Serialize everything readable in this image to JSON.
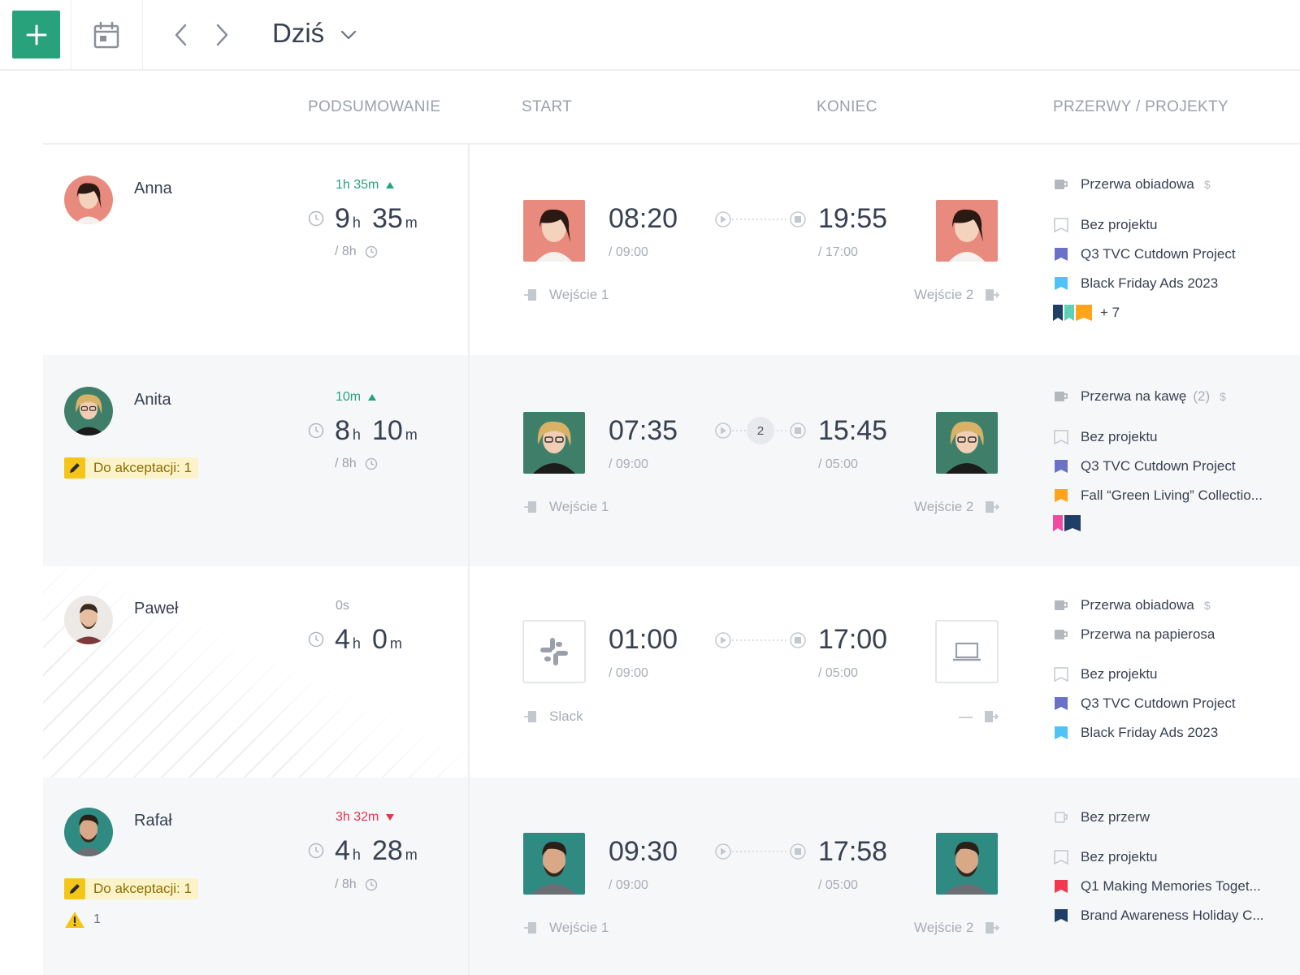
{
  "toolbar": {
    "date_label": "Dziś"
  },
  "columns": {
    "summary": "PODSUMOWANIE",
    "start": "START",
    "end": "KONIEC",
    "breaks_projects": "PRZERWY / PROJEKTY"
  },
  "rows": [
    {
      "name": "Anna",
      "diff": "1h 35m",
      "diff_dir": "up",
      "total_h": "9",
      "total_m": "35",
      "unit_h": "h",
      "unit_m": "m",
      "target": "/ 8h",
      "start": "08:20",
      "start_sub": "/ 09:00",
      "start_src": "Wejście 1",
      "end": "19:55",
      "end_sub": "/ 17:00",
      "end_src": "Wejście 2",
      "breaks": [
        {
          "label": "Przerwa obiadowa",
          "dollar": "$"
        }
      ],
      "projects": [
        {
          "label": "Bez projektu",
          "color": "outline"
        },
        {
          "label": "Q3 TVC Cutdown Project",
          "color": "#6a72c8"
        },
        {
          "label": "Black Friday Ads 2023",
          "color": "#4fc3f7"
        }
      ],
      "extra_flags": [
        "#1f3f66",
        "#5fd0b8",
        "#ffa41b"
      ],
      "extra_more": "+ 7"
    },
    {
      "name": "Anita",
      "badge": "Do akceptacji: 1",
      "diff": "10m",
      "diff_dir": "up",
      "total_h": "8",
      "total_m": "10",
      "unit_h": "h",
      "unit_m": "m",
      "target": "/ 8h",
      "start": "07:35",
      "start_sub": "/ 09:00",
      "start_src": "Wejście 1",
      "end": "15:45",
      "end_sub": "/ 05:00",
      "end_src": "Wejście 2",
      "break_count": "2",
      "breaks": [
        {
          "label": "Przerwa na kawę",
          "extra": "(2)",
          "dollar": "$"
        }
      ],
      "projects": [
        {
          "label": "Bez projektu",
          "color": "outline"
        },
        {
          "label": "Q3 TVC Cutdown Project",
          "color": "#6a72c8"
        },
        {
          "label": "Fall “Green Living” Collectio...",
          "color": "#ffa41b"
        }
      ],
      "extra_flags": [
        "#f24aa2",
        "#1f3f66"
      ]
    },
    {
      "name": "Paweł",
      "diff": "0s",
      "diff_dir": "zero",
      "total_h": "4",
      "total_m": "0",
      "unit_h": "h",
      "unit_m": "m",
      "start": "01:00",
      "start_sub": "/ 09:00",
      "start_src": "Slack",
      "end": "17:00",
      "end_sub": "/ 05:00",
      "end_src": "—",
      "breaks": [
        {
          "label": "Przerwa obiadowa",
          "dollar": "$"
        },
        {
          "label": "Przerwa na papierosa"
        }
      ],
      "projects": [
        {
          "label": "Bez projektu",
          "color": "outline"
        },
        {
          "label": "Q3 TVC Cutdown Project",
          "color": "#6a72c8"
        },
        {
          "label": "Black Friday Ads 2023",
          "color": "#4fc3f7"
        }
      ]
    },
    {
      "name": "Rafał",
      "badge": "Do akceptacji: 1",
      "warning_count": "1",
      "diff": "3h 32m",
      "diff_dir": "down",
      "total_h": "4",
      "total_m": "28",
      "unit_h": "h",
      "unit_m": "m",
      "target": "/ 8h",
      "start": "09:30",
      "start_sub": "/ 09:00",
      "start_src": "Wejście 1",
      "end": "17:58",
      "end_sub": "/ 05:00",
      "end_src": "Wejście 2",
      "breaks": [
        {
          "label": "Bez przerw"
        }
      ],
      "projects": [
        {
          "label": "Bez projektu",
          "color": "outline"
        },
        {
          "label": "Q1 Making Memories Toget...",
          "color": "#f0384f"
        },
        {
          "label": "Brand Awareness Holiday C...",
          "color": "#1f3f66"
        }
      ]
    }
  ]
}
